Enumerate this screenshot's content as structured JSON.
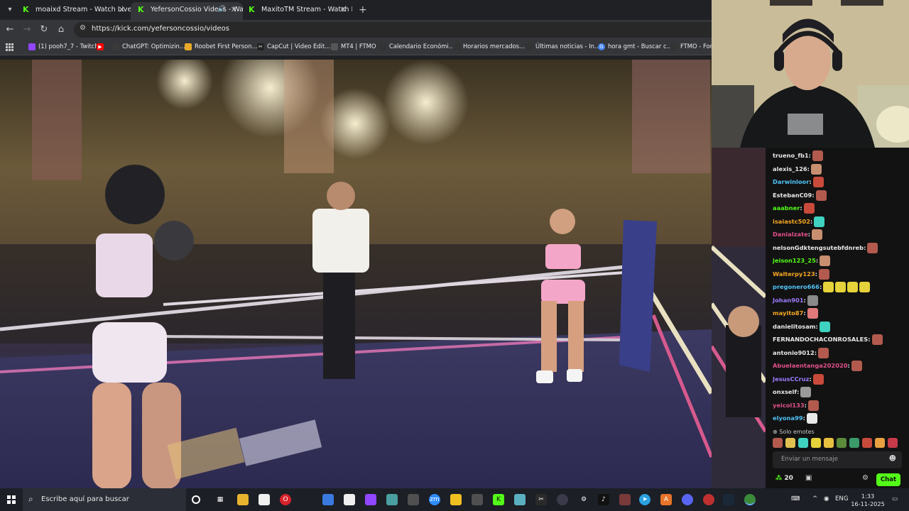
{
  "browser": {
    "tabs": [
      {
        "title": "moaixd Stream - Watch Live on",
        "active": false,
        "audio": false
      },
      {
        "title": "YefersonCossio Videos - Wa",
        "active": true,
        "audio": true
      },
      {
        "title": "MaxitoTM Stream - Watch Live",
        "active": false,
        "audio": false
      }
    ],
    "url": "https://kick.com/yefersoncossio/videos",
    "bookmarks": [
      {
        "label": "(1) pooh7_7 - Twitch",
        "icon": "twitch-icon",
        "color": "#9146ff"
      },
      {
        "label": "",
        "icon": "youtube-icon",
        "color": "#ff0000"
      },
      {
        "label": "ChatGPT: Optimizin...",
        "icon": "chatgpt-icon",
        "color": "#3a3a3a"
      },
      {
        "label": "Roobet First Person...",
        "icon": "roobet-icon",
        "color": "#e8a92a"
      },
      {
        "label": "CapCut | Video Edit...",
        "icon": "capcut-icon",
        "color": "#222222"
      },
      {
        "label": "MT4 | FTMO",
        "icon": "mt4-icon",
        "color": "#555555"
      },
      {
        "label": "Calendario Económi...",
        "icon": "investing-icon",
        "color": "#333333"
      },
      {
        "label": "Horarios mercados...",
        "icon": "investing-icon",
        "color": "#333333"
      },
      {
        "label": "Últimas noticias - In...",
        "icon": "investing-icon",
        "color": "#333333"
      },
      {
        "label": "hora gmt - Buscar c...",
        "icon": "google-icon",
        "color": "#4285f4"
      },
      {
        "label": "FTMO - For",
        "icon": "ftmo-icon",
        "color": "#333333"
      }
    ]
  },
  "chat": {
    "messages": [
      {
        "user": "trueno_fb1",
        "color": "#e8e8e8",
        "emotes": [
          "#b25a4e"
        ]
      },
      {
        "user": "alexis_126",
        "color": "#e8e8e8",
        "emotes": [
          "#c88e70"
        ]
      },
      {
        "user": "Darwinloor",
        "color": "#4fc3f7",
        "emotes": [
          "#c84a3a"
        ]
      },
      {
        "user": "EstebanC09",
        "color": "#e8e8e8",
        "emotes": [
          "#b25a4e"
        ]
      },
      {
        "user": "aaabner",
        "color": "#53fc18",
        "emotes": [
          "#c84a3a"
        ]
      },
      {
        "user": "isaiastc502",
        "color": "#f5a623",
        "emotes": [
          "#3fd2c0"
        ]
      },
      {
        "user": "Danialzate",
        "color": "#e0508a",
        "emotes": [
          "#c88e70"
        ]
      },
      {
        "user": "nelsonGdktengsutebfdnreb",
        "color": "#e8e8e8",
        "emotes": [
          "#b25a4e"
        ]
      },
      {
        "user": "jeison123_25",
        "color": "#53fc18",
        "emotes": [
          "#c88e70"
        ]
      },
      {
        "user": "Walterpy123",
        "color": "#f5a623",
        "emotes": [
          "#b25a4e"
        ]
      },
      {
        "user": "pregonero666",
        "color": "#4fc3f7",
        "emotes": [
          "#e6d23a",
          "#e6d23a",
          "#e6d23a",
          "#e6d23a"
        ]
      },
      {
        "user": "Johan901",
        "color": "#9b7bff",
        "emotes": [
          "#8a8a8a"
        ]
      },
      {
        "user": "mayito87",
        "color": "#f5a623",
        "emotes": [
          "#e07a7a"
        ]
      },
      {
        "user": "danielitosam",
        "color": "#e8e8e8",
        "emotes": [
          "#3fd2c0"
        ]
      },
      {
        "user": "FERNANDOCHACONROSALES",
        "color": "#e8e8e8",
        "emotes": [
          "#b25a4e"
        ]
      },
      {
        "user": "antonio9012",
        "color": "#e8e8e8",
        "emotes": [
          "#b25a4e"
        ]
      },
      {
        "user": "Abuelaentanga202020",
        "color": "#e0508a",
        "emotes": [
          "#b25a4e"
        ]
      },
      {
        "user": "JesusCCruz",
        "color": "#9b7bff",
        "emotes": [
          "#c84a3a"
        ]
      },
      {
        "user": "onxself",
        "color": "#e8e8e8",
        "emotes": [
          "#9a9a9a"
        ]
      },
      {
        "user": "yeicol133",
        "color": "#e0508a",
        "emotes": [
          "#b25a4e"
        ]
      },
      {
        "user": "elyona99",
        "color": "#4fc3f7",
        "emotes": [
          "#e8e8e8"
        ]
      }
    ],
    "mode_label": "Solo emotes",
    "input_placeholder": "Enviar un mensaje",
    "points": "20",
    "chat_button": "Chat"
  },
  "taskbar": {
    "search_placeholder": "Escribe aquí para buscar",
    "language": "ENG",
    "time": "1:33",
    "date": "16-11-2025"
  }
}
